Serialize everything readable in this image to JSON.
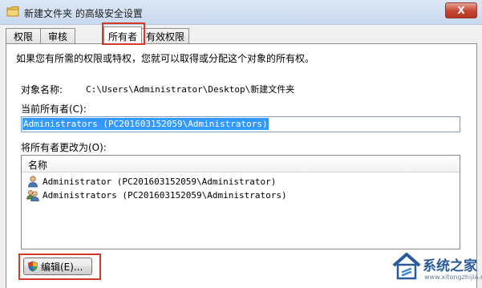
{
  "window": {
    "title": "新建文件夹 的高级安全设置",
    "close_label": "X"
  },
  "tabs": [
    {
      "label": "权限",
      "active": false
    },
    {
      "label": "审核",
      "active": false
    },
    {
      "label": "所有者",
      "active": true
    },
    {
      "label": "有效权限",
      "active": false
    }
  ],
  "owner_tab": {
    "instruction": "如果您有所需的权限或特权，您就可以取得或分配这个对象的所有权。",
    "object_name_label": "对象名称:",
    "object_name_value": "C:\\Users\\Administrator\\Desktop\\新建文件夹",
    "current_owner_label": "当前所有者(C):",
    "current_owner_value": "Administrators (PC201603152059\\Administrators)",
    "change_owner_label": "将所有者更改为(O):",
    "list_header": "名称",
    "list_items": [
      {
        "name": "Administrator (PC201603152059\\Administrator)",
        "icon": "single-user-icon"
      },
      {
        "name": "Administrators (PC201603152059\\Administrators)",
        "icon": "group-users-icon"
      }
    ],
    "edit_button_label": "编辑(E)..."
  },
  "watermark": {
    "text": "系统之家",
    "url": "www.xitongzhijia.net"
  },
  "colors": {
    "highlight_box": "#d23a2a",
    "selection": "#3399ff",
    "titlebar": "#c9d9ef"
  }
}
